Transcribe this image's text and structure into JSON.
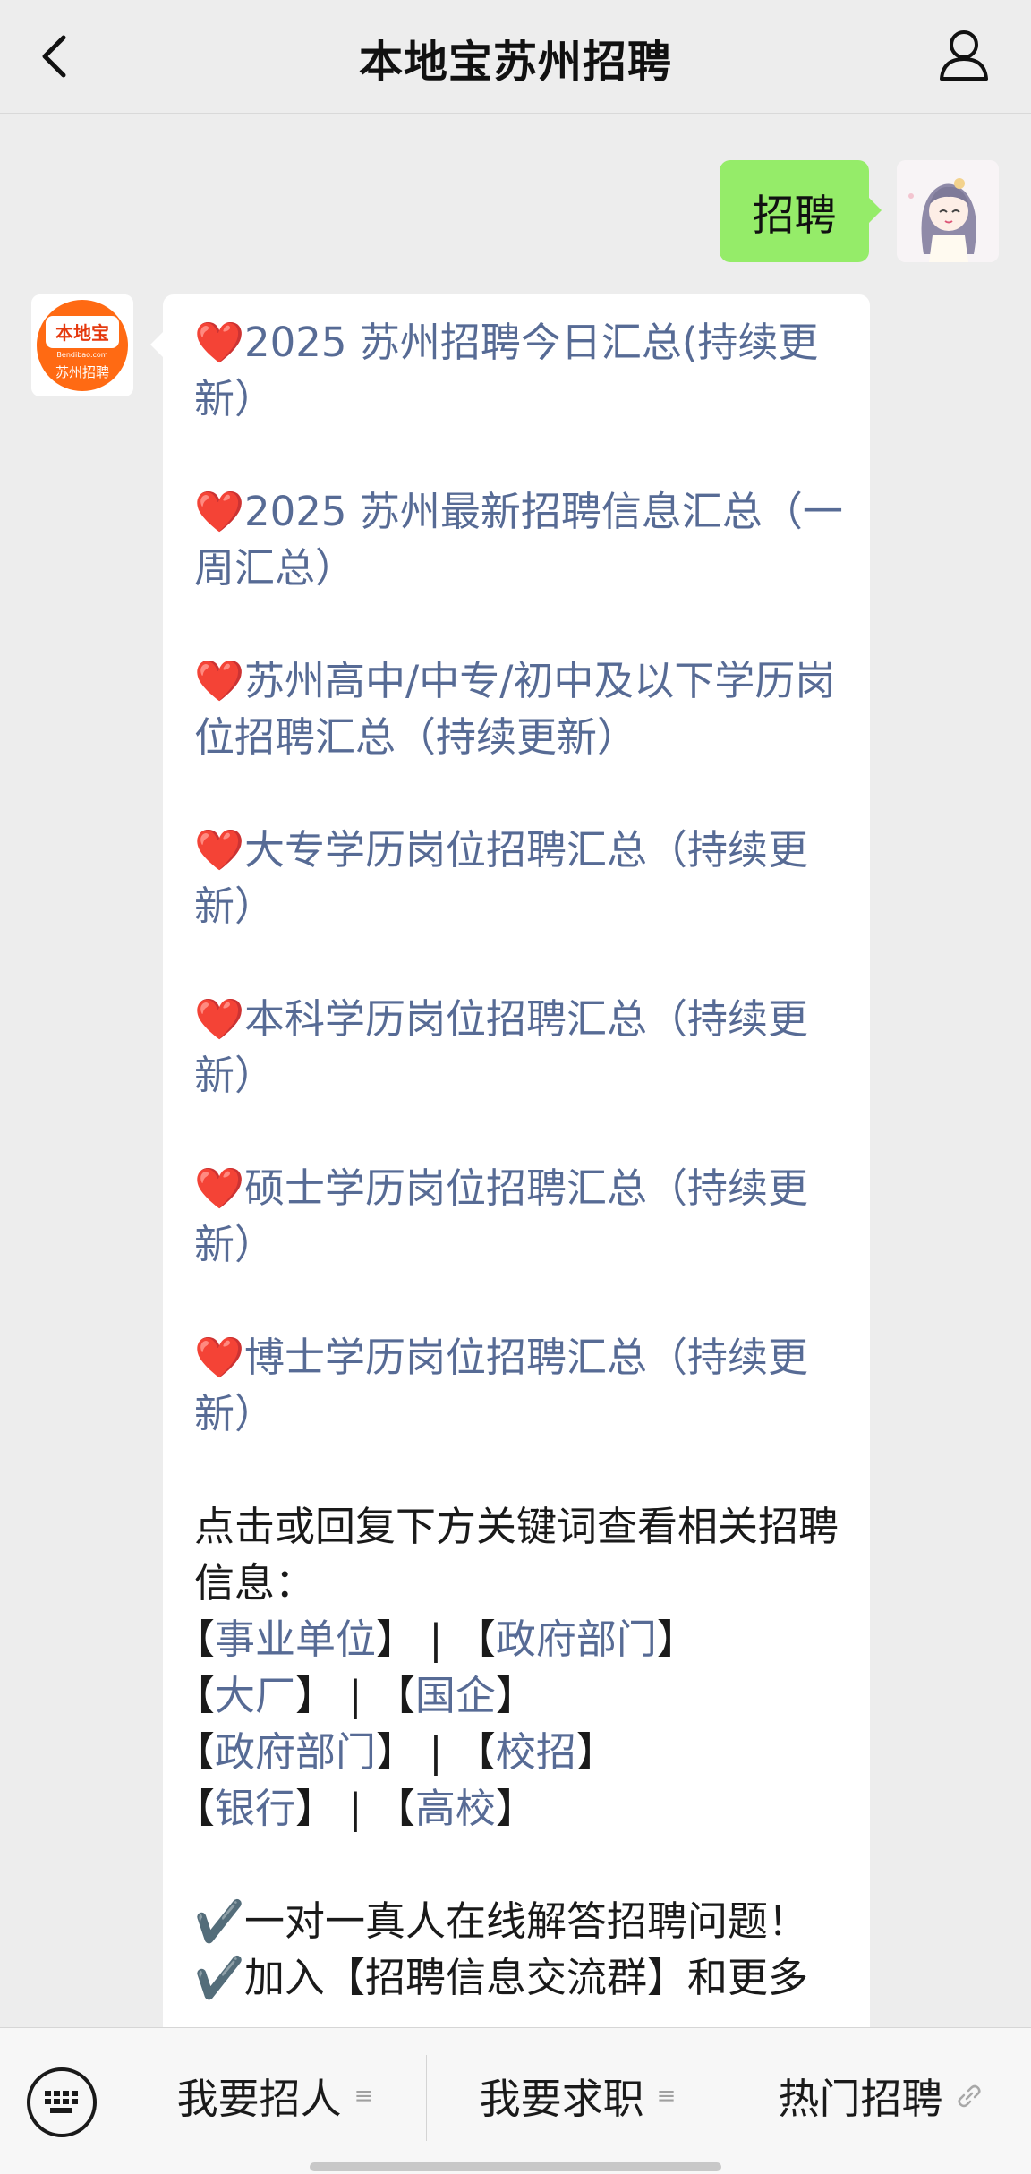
{
  "header": {
    "title": "本地宝苏州招聘"
  },
  "chat": {
    "outgoing_text": "招聘",
    "bot_avatar": {
      "line1": "本地宝",
      "line2": "Bendibao.com",
      "line3": "苏州招聘"
    },
    "links": [
      "2025 苏州招聘今日汇总(持续更新）",
      "2025 苏州最新招聘信息汇总（一周汇总）",
      "苏州高中/中专/初中及以下学历岗位招聘汇总（持续更新）",
      "大专学历岗位招聘汇总（持续更新）",
      "本科学历岗位招聘汇总（持续更新）",
      "硕士学历岗位招聘汇总（持续更新）",
      "博士学历岗位招聘汇总（持续更新）"
    ],
    "heart": "❤️",
    "instruction": "点击或回复下方关键词查看相关招聘信息：",
    "keywords": [
      [
        "事业单位",
        "政府部门"
      ],
      [
        "大厂",
        "国企"
      ],
      [
        "政府部门",
        "校招"
      ],
      [
        "银行",
        "高校"
      ]
    ],
    "bracket_open": "【",
    "bracket_close": "】",
    "separator": "|",
    "check_mark": "✔️",
    "check_items": [
      "一对一真人在线解答招聘问题！",
      "加入【招聘信息交流群】和更多"
    ]
  },
  "bottom_menu": {
    "items": [
      "我要招人",
      "我要求职",
      "热门招聘"
    ],
    "menu_icon": "≡",
    "link_icon": "link-icon"
  },
  "colors": {
    "background": "#ededed",
    "outgoing_bubble": "#95ec69",
    "link": "#576b95",
    "heart": "#e0201b"
  }
}
